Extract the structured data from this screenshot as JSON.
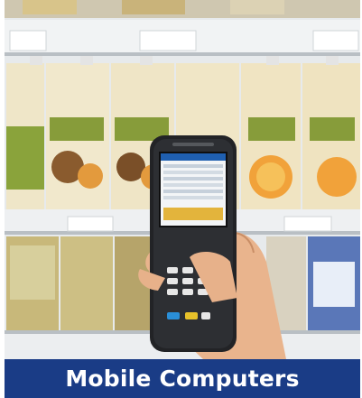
{
  "caption": {
    "title": "Mobile Computers"
  },
  "photo": {
    "alt_subject": "scanner-photo"
  },
  "colors": {
    "caption_bg": "#1a3c86",
    "caption_text": "#ffffff",
    "carton_orange": "#e9a24a",
    "carton_green": "#7c8a32",
    "carton_red": "#b8445a"
  }
}
